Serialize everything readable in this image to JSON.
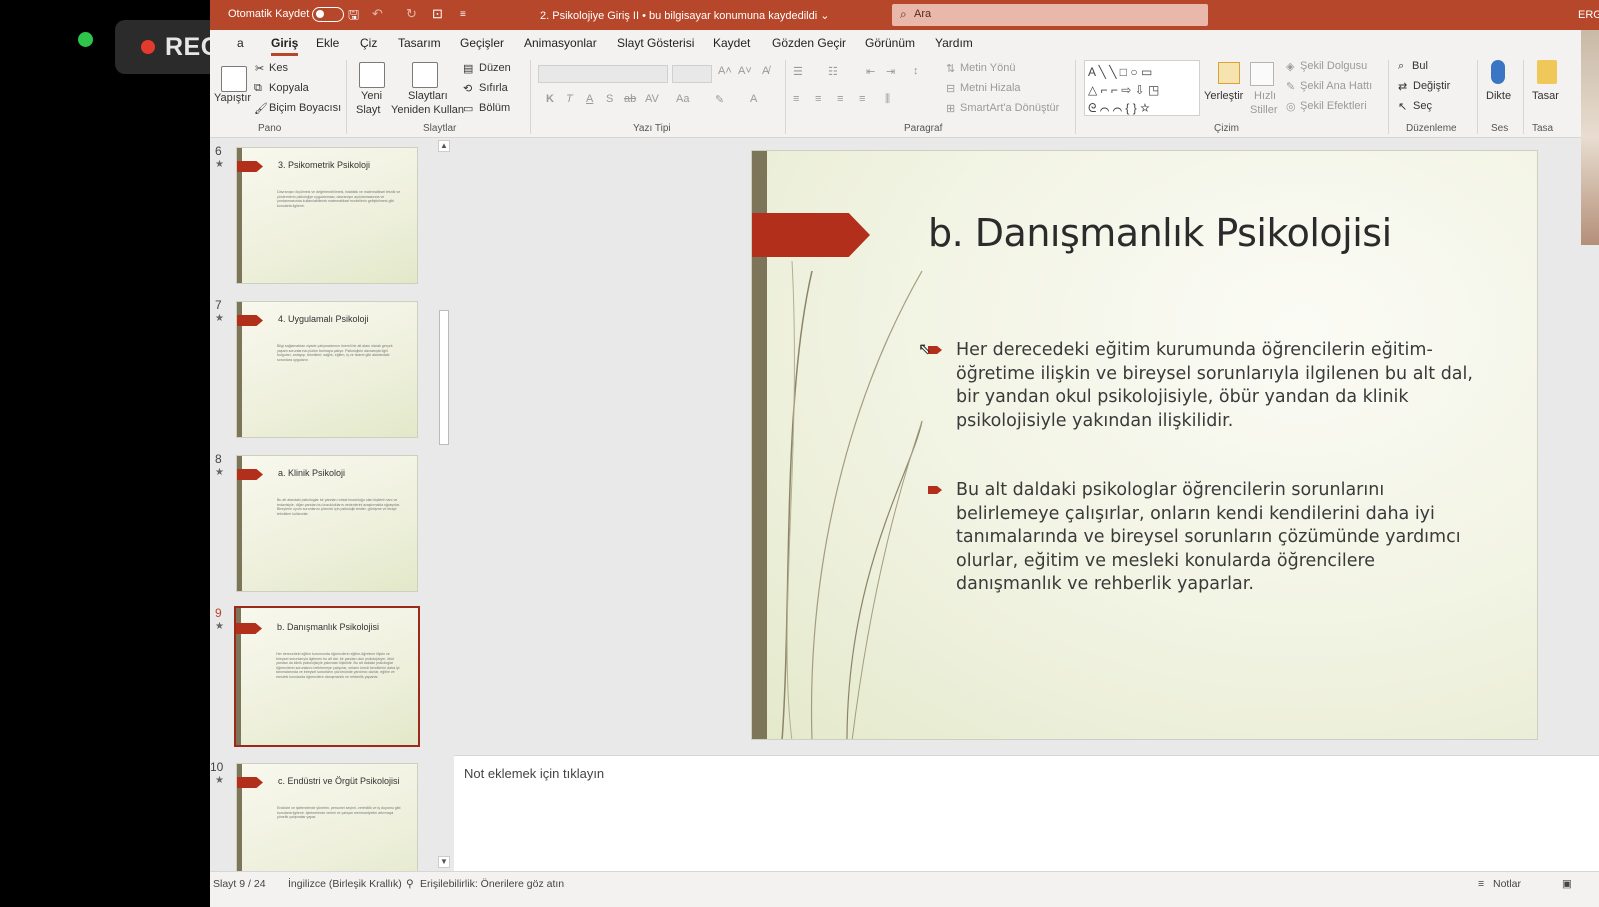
{
  "recording": {
    "label": "REC"
  },
  "titlebar": {
    "autosave_label": "Otomatik Kaydet",
    "document": "2. Psikolojiye Giriş II • bu bilgisayar konumuna kaydedildi ⌄",
    "search_placeholder": "Ara",
    "user": "ERG"
  },
  "tabs": [
    "a",
    "Giriş",
    "Ekle",
    "Çiz",
    "Tasarım",
    "Geçişler",
    "Animasyonlar",
    "Slayt Gösterisi",
    "Kaydet",
    "Gözden Geçir",
    "Görünüm",
    "Yardım"
  ],
  "ribbon": {
    "pano": {
      "paste": "Yapıştır",
      "cut": "Kes",
      "copy": "Kopyala",
      "format_painter": "Biçim Boyacısı",
      "group": "Pano"
    },
    "slaytlar": {
      "new_slide_1": "Yeni",
      "new_slide_2": "Slayt",
      "reuse_1": "Slaytları",
      "reuse_2": "Yeniden Kullan",
      "layout": "Düzen",
      "reset": "Sıfırla",
      "section": "Bölüm",
      "group": "Slaytlar"
    },
    "font": {
      "group": "Yazı Tipi"
    },
    "paragraph": {
      "text_direction": "Metin Yönü",
      "align_text": "Metni Hizala",
      "smartart": "SmartArt'a Dönüştür",
      "group": "Paragraf"
    },
    "drawing": {
      "arrange": "Yerleştir",
      "quick_styles_1": "Hızlı",
      "quick_styles_2": "Stiller",
      "shape_fill": "Şekil Dolgusu",
      "shape_outline": "Şekil Ana Hattı",
      "shape_effects": "Şekil Efektleri",
      "group": "Çizim"
    },
    "editing": {
      "find": "Bul",
      "replace": "Değiştir",
      "select": "Seç",
      "group": "Düzenleme"
    },
    "voice": {
      "dictate": "Dikte",
      "group": "Ses"
    },
    "designer": {
      "label": "Tasar",
      "group": "Tasa"
    }
  },
  "thumbnails": [
    {
      "number": "6",
      "title": "3. Psikometrik Psikoloji",
      "text": "Davranışın ölçülmesi ve değerlendirilmesi, istatistik ve matematiksel teknik ve yöntemlerin psikolojiye uygulanması; davranışın açıklanmasında ve yordanmasında kullanılabilecek matematiksel modellerin geliştirilmesi gibi konularla ilgilenir."
    },
    {
      "number": "7",
      "title": "4. Uygulamalı Psikoloji",
      "text": "Bilgi sağlamaktan ziyade çalışmalarının önemli bir alt alanı olarak gerçek yaşam sorunlarına çözüm bulmaya çalışır. Psikolojinin davranışla ilgili bulguları, anlayışı, teknikleri; sağlık, eğitim, iş ve ticaret gibi alanlardaki sorunlara uygulanır."
    },
    {
      "number": "8",
      "title": "a. Klinik Psikoloji",
      "text": "Bu alt alandaki psikologlar bir yandan ruhsal bozukluğu olan kişilerin tanı ve tedavisiyle, diğer yandan bu bozuklukların nedenlerini araştırmakla uğraşırlar. Bireylerin uyum sorunlarını çözmek için psikolojik testler, görüşme ve terapi teknikleri kullanırlar."
    },
    {
      "number": "9",
      "title": "b. Danışmanlık Psikolojisi",
      "text": "Her derecedeki eğitim kurumunda öğrencilerin eğitim-öğretime ilişkin ve bireysel sorunlarıyla ilgilenen bu alt dal, bir yandan okul psikolojisiyle, öbür yandan da klinik psikolojisiyle yakından ilişkilidir. Bu alt daldaki psikologlar öğrencilerin sorunlarını belirlemeye çalışırlar, onların kendi kendilerini daha iyi tanımalarında ve bireysel sorunların çözümünde yardımcı olurlar, eğitim ve mesleki konularda öğrencilere danışmanlık ve rehberlik yaparlar."
    },
    {
      "number": "10",
      "title": "c. Endüstri ve Örgüt Psikolojisi",
      "text": "Endüstri ve işletmelerde yönetim, personel seçimi, verimlilik ve iş doyumu gibi konularla ilgilenir. İşletmelerde verimi ve çalışan memnuniyetini artırmaya yönelik çalışmalar yapar."
    }
  ],
  "slide": {
    "title": "b. Danışmanlık Psikolojisi",
    "bullets": [
      "Her derecedeki eğitim kurumunda öğrencilerin eğitim-öğretime ilişkin ve bireysel sorunlarıyla ilgilenen bu alt dal, bir yandan okul psikolojisiyle, öbür yandan da klinik psikolojisiyle yakından ilişkilidir.",
      "Bu alt daldaki psikologlar öğrencilerin sorunlarını belirlemeye çalışırlar, onların kendi kendilerini daha iyi tanımalarında ve bireysel sorunların çözümünde yardımcı olurlar, eğitim ve mesleki konularda öğrencilere danışmanlık ve rehberlik yaparlar."
    ],
    "accent_color": "#b22f1c"
  },
  "notes": {
    "placeholder": "Not eklemek için tıklayın"
  },
  "statusbar": {
    "slide_count": "Slayt 9 / 24",
    "language": "İngilizce (Birleşik Krallık)",
    "accessibility": "Erişilebilirlik: Önerilere göz atın",
    "notes_button": "Notlar"
  },
  "colors": {
    "brand": "#b7472a",
    "ribbon_bg": "#f3f2f1"
  }
}
